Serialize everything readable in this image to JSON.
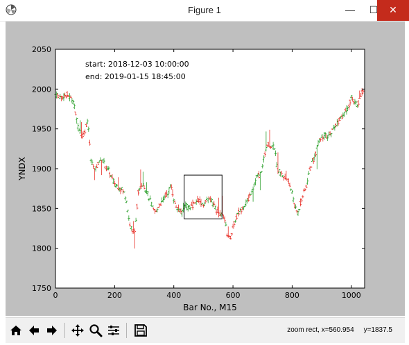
{
  "window": {
    "title": "Figure 1",
    "controls": {
      "minimize": "—",
      "maximize": "☐",
      "close": "✕"
    },
    "icon": "matplotlib-icon"
  },
  "toolbar": {
    "buttons": [
      "home-icon",
      "back-icon",
      "forward-icon",
      "pan-icon",
      "zoom-icon",
      "subplots-icon",
      "save-icon"
    ],
    "status": "zoom rect, x=560.954     y=1837.5"
  },
  "chart_data": {
    "type": "line",
    "title": "",
    "xlabel": "Bar No., M15",
    "ylabel": "YNDX",
    "xlim": [
      0,
      1045
    ],
    "ylim": [
      1750,
      2050
    ],
    "xticks": [
      0,
      200,
      400,
      600,
      800,
      1000
    ],
    "yticks": [
      1750,
      1800,
      1850,
      1900,
      1950,
      2000,
      2050
    ],
    "annotations": [
      "start: 2018-12-03 10:00:00",
      "end: 2019-01-15 18:45:00"
    ],
    "up_color": "#2ca02c",
    "down_color": "#e8322a",
    "zoom_rect": {
      "x": [
        435,
        563
      ],
      "y": [
        1837,
        1892
      ]
    },
    "series": [
      {
        "x": [
          0,
          20,
          40,
          60,
          75,
          90,
          100,
          110,
          120,
          130,
          140,
          150,
          160,
          170,
          180,
          190,
          200,
          210,
          220,
          230,
          240,
          250,
          260,
          270,
          280,
          290,
          300,
          310,
          320,
          330,
          340,
          350,
          360,
          370,
          380,
          390,
          400,
          410,
          420,
          430,
          440,
          450,
          460,
          470,
          480,
          490,
          500,
          510,
          520,
          530,
          540,
          550,
          560,
          570,
          580,
          590,
          600,
          610,
          620,
          630,
          640,
          650,
          660,
          670,
          680,
          690,
          700,
          710,
          720,
          730,
          740,
          750,
          760,
          770,
          780,
          790,
          800,
          810,
          820,
          830,
          840,
          850,
          860,
          870,
          880,
          890,
          900,
          910,
          920,
          930,
          940,
          950,
          960,
          970,
          980,
          990,
          1000,
          1010,
          1020,
          1030,
          1040
        ],
        "values": [
          1993,
          1990,
          1993,
          1985,
          1955,
          1940,
          1948,
          1960,
          1910,
          1900,
          1902,
          1910,
          1912,
          1900,
          1898,
          1888,
          1882,
          1878,
          1875,
          1872,
          1860,
          1832,
          1820,
          1825,
          1870,
          1880,
          1878,
          1870,
          1860,
          1848,
          1845,
          1855,
          1858,
          1865,
          1870,
          1880,
          1862,
          1850,
          1848,
          1845,
          1855,
          1850,
          1852,
          1856,
          1860,
          1858,
          1855,
          1860,
          1862,
          1858,
          1850,
          1845,
          1842,
          1840,
          1818,
          1812,
          1825,
          1838,
          1845,
          1850,
          1855,
          1860,
          1870,
          1878,
          1890,
          1892,
          1902,
          1925,
          1930,
          1928,
          1927,
          1900,
          1895,
          1890,
          1888,
          1880,
          1870,
          1850,
          1845,
          1860,
          1870,
          1880,
          1900,
          1910,
          1920,
          1935,
          1940,
          1942,
          1938,
          1945,
          1950,
          1955,
          1962,
          1965,
          1972,
          1975,
          1990,
          1985,
          1978,
          1990,
          2000
        ]
      }
    ]
  }
}
